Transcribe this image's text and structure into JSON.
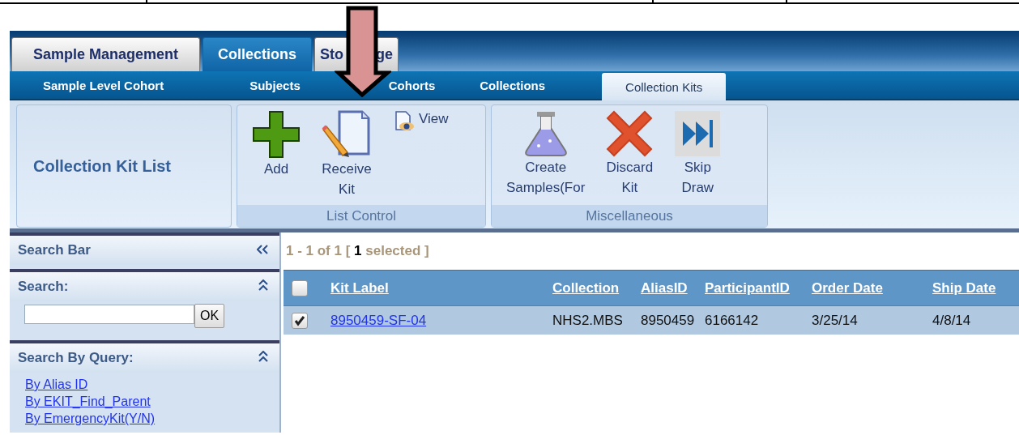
{
  "tabs": [
    {
      "label": "Sample Management",
      "selected": false
    },
    {
      "label": "Collections",
      "selected": true
    },
    {
      "texts": [
        "Sto",
        "ge"
      ],
      "selected": false
    }
  ],
  "subtabs": [
    {
      "label": "Sample Level Cohort",
      "selected": false
    },
    {
      "label": "Subjects",
      "selected": false
    },
    {
      "label": "Cohorts",
      "selected": false
    },
    {
      "label": "Collections",
      "selected": false
    },
    {
      "label": "Collection Kits",
      "selected": true
    }
  ],
  "ribbon": {
    "title": "Collection Kit List",
    "groups": [
      {
        "label": "List Control",
        "buttons": [
          {
            "kind": "add",
            "label": "Add"
          },
          {
            "kind": "receive",
            "label": "Receive Kit"
          },
          {
            "kind": "view",
            "label": "View"
          }
        ]
      },
      {
        "label": "Miscellaneous",
        "buttons": [
          {
            "kind": "flask",
            "label": "Create Samples(For"
          },
          {
            "kind": "discard",
            "label": "Discard Kit"
          },
          {
            "kind": "skip",
            "label": "Skip Draw"
          }
        ]
      }
    ]
  },
  "sidebar": {
    "title": "Search Bar",
    "search": {
      "title": "Search:",
      "button": "OK"
    },
    "query": {
      "title": "Search By Query:",
      "links": [
        "By Alias ID",
        "By EKIT_Find_Parent",
        "By EmergencyKit(Y/N)"
      ]
    }
  },
  "results": {
    "summary": "1 - 1 of 1 [ **1** selected ]"
  },
  "table": {
    "header_checked": false,
    "columns": [
      "Kit Label",
      "Collection",
      "AliasID",
      "ParticipantID",
      "Order Date",
      "Ship Date"
    ],
    "rows": [
      {
        "checked": true,
        "selected": true,
        "cells": [
          "8950459-SF-04",
          "NHS2.MBS",
          "8950459",
          "6166142",
          "3/25/14",
          "4/8/14"
        ]
      }
    ]
  }
}
